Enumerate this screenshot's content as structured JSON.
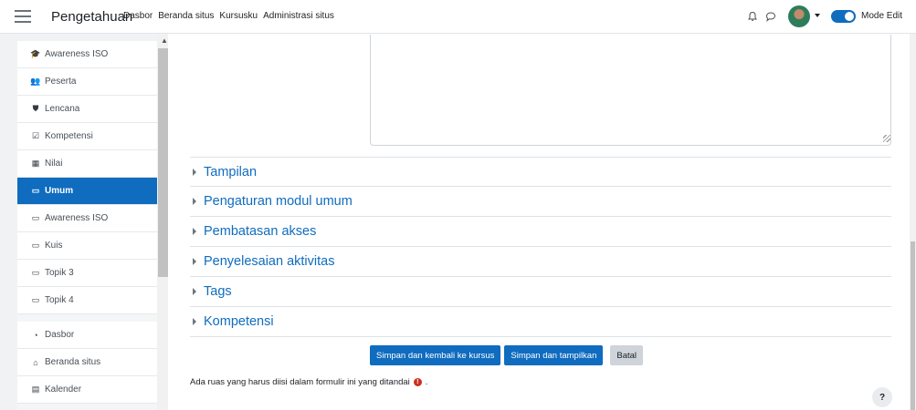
{
  "navbar": {
    "brand": "Pengetahuan",
    "links": [
      "Dasbor",
      "Beranda situs",
      "Kursusku",
      "Administrasi situs"
    ],
    "mode_label": "Mode Edit"
  },
  "sidebar": {
    "course_items": [
      {
        "icon": "graduation-cap-icon",
        "glyph": "🎓",
        "label": "Awareness ISO"
      },
      {
        "icon": "users-icon",
        "glyph": "👥",
        "label": "Peserta"
      },
      {
        "icon": "shield-icon",
        "glyph": "⛊",
        "label": "Lencana"
      },
      {
        "icon": "check-square-icon",
        "glyph": "☑",
        "label": "Kompetensi"
      },
      {
        "icon": "table-icon",
        "glyph": "▦",
        "label": "Nilai"
      },
      {
        "icon": "folder-icon",
        "glyph": "▭",
        "label": "Umum",
        "active": true
      },
      {
        "icon": "folder-icon",
        "glyph": "▭",
        "label": "Awareness ISO"
      },
      {
        "icon": "folder-icon",
        "glyph": "▭",
        "label": "Kuis"
      },
      {
        "icon": "folder-icon",
        "glyph": "▭",
        "label": "Topik 3"
      },
      {
        "icon": "folder-icon",
        "glyph": "▭",
        "label": "Topik 4"
      }
    ],
    "site_items": [
      {
        "icon": "dashboard-icon",
        "glyph": "◔",
        "label": "Dasbor"
      },
      {
        "icon": "home-icon",
        "glyph": "⌂",
        "label": "Beranda situs"
      },
      {
        "icon": "calendar-icon",
        "glyph": "▤",
        "label": "Kalender"
      }
    ]
  },
  "form": {
    "sections": [
      "Tampilan",
      "Pengaturan modul umum",
      "Pembatasan akses",
      "Penyelesaian aktivitas",
      "Tags",
      "Kompetensi"
    ],
    "buttons": {
      "save_return": "Simpan dan kembali ke kursus",
      "save_display": "Simpan dan tampilkan",
      "cancel": "Batal"
    },
    "required_note": "Ada ruas yang harus diisi dalam formulir ini yang ditandai",
    "required_suffix": "."
  },
  "help": {
    "label": "?"
  },
  "colors": {
    "primary": "#0f6cbf",
    "required": "#ca3120"
  }
}
